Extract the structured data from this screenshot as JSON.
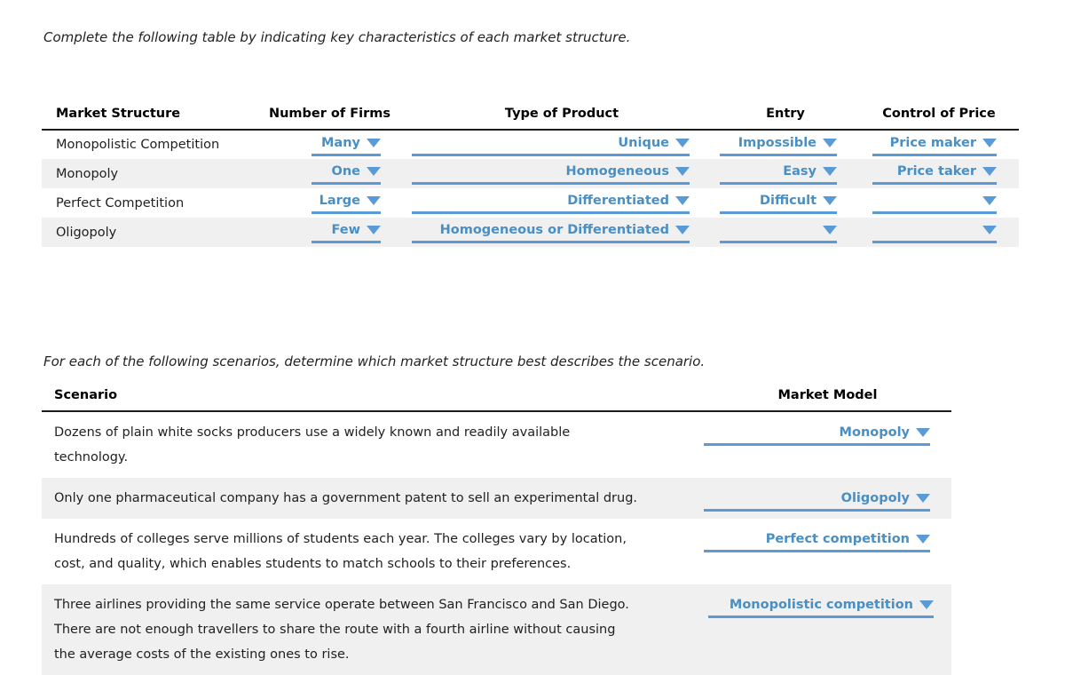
{
  "prompt_1": "Complete the following table by indicating key characteristics of each market structure.",
  "prompt_2": "For each of the following scenarios, determine which market structure best describes the scenario.",
  "market_structure_table": {
    "headers": [
      "Market Structure",
      "Number of Firms",
      "Type of Product",
      "Entry",
      "Control of Price"
    ],
    "rows": [
      {
        "structure": "Monopolistic Competition",
        "firms": "Many",
        "product": "Unique",
        "entry": "Impossible",
        "price": "Price maker"
      },
      {
        "structure": "Monopoly",
        "firms": "One",
        "product": "Homogeneous",
        "entry": "Easy",
        "price": "Price taker"
      },
      {
        "structure": "Perfect Competition",
        "firms": "Large",
        "product": "Differentiated",
        "entry": "Difficult",
        "price": ""
      },
      {
        "structure": "Oligopoly",
        "firms": "Few",
        "product": "Homogeneous or Differentiated",
        "entry": "",
        "price": ""
      }
    ]
  },
  "scenarios_table": {
    "headers": [
      "Scenario",
      "Market Model"
    ],
    "rows": [
      {
        "lines": [
          "Dozens of plain white socks producers use a widely known and readily available",
          "technology."
        ],
        "model": "Monopoly"
      },
      {
        "lines": [
          "Only one pharmaceutical company has a government patent to sell an experimental drug."
        ],
        "model": "Oligopoly"
      },
      {
        "lines": [
          "Hundreds of colleges serve millions of students each year. The colleges vary by location,",
          "cost, and quality, which enables students to match schools to their preferences."
        ],
        "model": "Perfect competition"
      },
      {
        "lines": [
          "Three airlines providing the same service operate between San Francisco and San Diego.",
          "There are not enough travellers to share the route with a fourth airline without causing",
          "the average costs of the existing ones to rise."
        ],
        "model": "Monopolistic competition"
      }
    ]
  },
  "icons": {
    "caret": "chevron-down-icon"
  },
  "colors": {
    "accent_blue": "#4a8fc4",
    "underline_blue": "#5b9bd5",
    "row_alt": "#f0f0f0",
    "rule_black": "#1c1c1c"
  }
}
